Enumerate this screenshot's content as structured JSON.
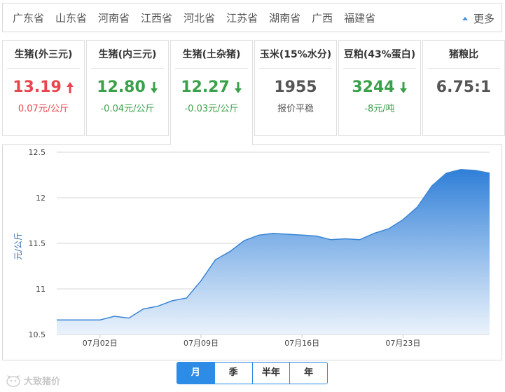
{
  "provinces": {
    "items": [
      "广东省",
      "山东省",
      "河南省",
      "江西省",
      "河北省",
      "江苏省",
      "湖南省",
      "广西",
      "福建省"
    ],
    "more_label": "更多"
  },
  "cards": [
    {
      "title": "生猪(外三元)",
      "value": "13.19",
      "change": "0.07元/公斤",
      "trend": "up"
    },
    {
      "title": "生猪(内三元)",
      "value": "12.80",
      "change": "-0.04元/公斤",
      "trend": "down"
    },
    {
      "title": "生猪(土杂猪)",
      "value": "12.27",
      "change": "-0.03元/公斤",
      "trend": "down",
      "active": true
    },
    {
      "title": "玉米(15%水分)",
      "value": "1955",
      "change": "报价平稳",
      "trend": "flat"
    },
    {
      "title": "豆粕(43%蛋白)",
      "value": "3244",
      "change": "-8元/吨",
      "trend": "down"
    },
    {
      "title": "猪粮比",
      "value": "6.75:1",
      "change": "",
      "trend": "flat"
    }
  ],
  "colors": {
    "up": "#e8454f",
    "down": "#3aa04a",
    "accent": "#2d8ce6",
    "series_line": "#3a85d6"
  },
  "chart_data": {
    "type": "area",
    "ylabel": "元/公斤",
    "ylim": [
      10.5,
      12.5
    ],
    "yticks": [
      "10.5",
      "11",
      "11.5",
      "12",
      "12.5"
    ],
    "xticks": [
      {
        "label": "07月02日",
        "index": 3
      },
      {
        "label": "07月09日",
        "index": 10
      },
      {
        "label": "07月16日",
        "index": 17
      },
      {
        "label": "07月23日",
        "index": 24
      }
    ],
    "grid": true,
    "series": [
      {
        "values": [
          10.66,
          10.66,
          10.66,
          10.66,
          10.7,
          10.68,
          10.78,
          10.81,
          10.87,
          10.9,
          11.09,
          11.32,
          11.41,
          11.53,
          11.59,
          11.61,
          11.6,
          11.59,
          11.58,
          11.54,
          11.55,
          11.54,
          11.61,
          11.66,
          11.76,
          11.9,
          12.13,
          12.27,
          12.31,
          12.3,
          12.27
        ]
      }
    ]
  },
  "range_tabs": [
    {
      "label": "月",
      "active": true
    },
    {
      "label": "季",
      "active": false
    },
    {
      "label": "半年",
      "active": false
    },
    {
      "label": "年",
      "active": false
    }
  ],
  "watermark": "大致猪价"
}
